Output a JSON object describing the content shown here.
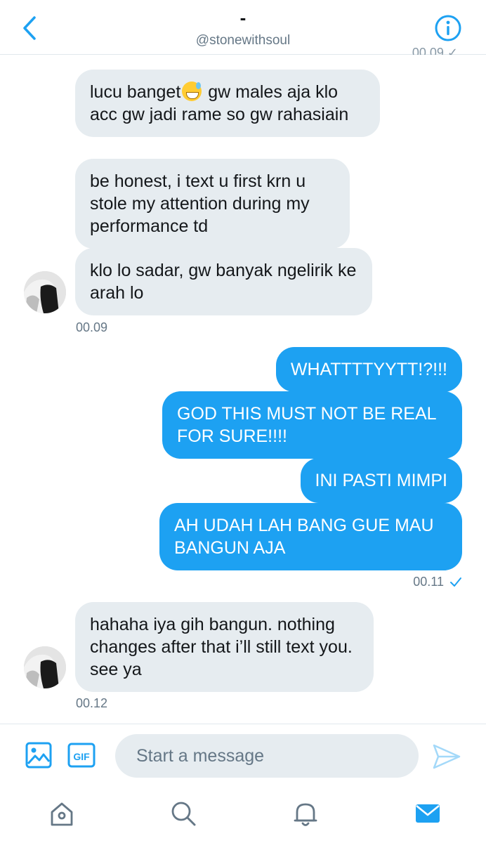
{
  "header": {
    "title": "-",
    "handle": "@stonewithsoul",
    "cut_timestamp": "00.09 ✓"
  },
  "messages": {
    "recv1": {
      "before_emoji": "lucu banget",
      "after_emoji": " gw males aja klo acc gw jadi rame so gw rahasiain"
    },
    "recv2": "be honest, i text u first krn u stole my attention during my performance td",
    "recv3": "klo lo sadar, gw banyak ngelirik ke arah lo",
    "ts1": "00.09",
    "sent1": "WHATTTTYYTT!?!!!",
    "sent2": "GOD THIS MUST NOT BE REAL FOR SURE!!!!",
    "sent3": "INI PASTI MIMPI",
    "sent4": "AH UDAH LAH BANG GUE MAU BANGUN AJA",
    "ts2": "00.11",
    "recv4": "hahaha iya gih bangun. nothing changes after that i’ll still text you. see ya",
    "ts3": "00.12"
  },
  "composer": {
    "placeholder": "Start a message",
    "gif_label": "GIF"
  },
  "icons": {
    "back": "chevron-left-icon",
    "info": "info-icon",
    "read_receipt": "checkmark-icon",
    "image": "image-icon",
    "gif": "gif-icon",
    "send": "send-icon",
    "home": "home-icon",
    "search": "search-icon",
    "notifications": "bell-icon",
    "messages": "mail-icon"
  },
  "colors": {
    "accent": "#1da1f2",
    "received_bubble": "#e6ecf0",
    "secondary_text": "#657786"
  }
}
